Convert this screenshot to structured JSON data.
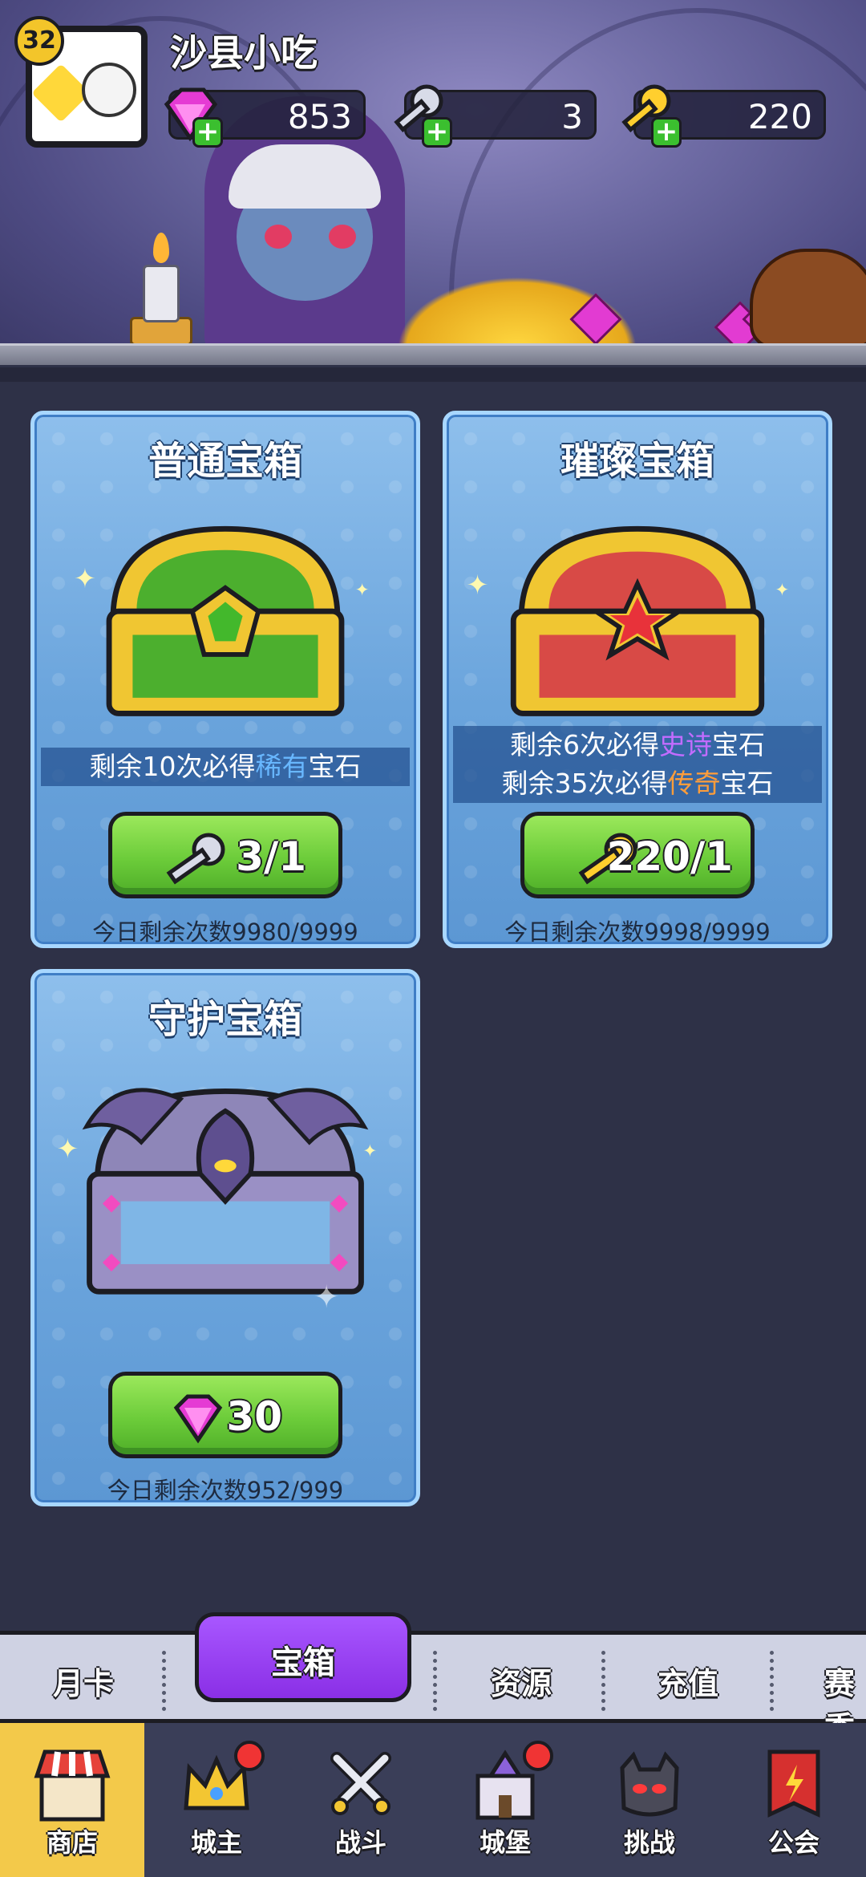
{
  "player": {
    "name": "沙县小吃",
    "level": "32"
  },
  "resources": [
    {
      "name": "gem",
      "value": "853"
    },
    {
      "name": "silver-key",
      "value": "3"
    },
    {
      "name": "gold-key",
      "value": "220"
    }
  ],
  "chests": {
    "normal": {
      "title": "普通宝箱",
      "pity_prefix": "剩余10次必得",
      "pity_rarity": "稀有",
      "pity_suffix": "宝石",
      "cost": "3/1",
      "cost_icon": "silver-key-icon",
      "daily": "今日剩余次数9980/9999"
    },
    "brilliant": {
      "title": "璀璨宝箱",
      "pity1_prefix": "剩余6次必得",
      "pity1_rarity": "史诗",
      "pity1_suffix": "宝石",
      "pity2_prefix": "剩余35次必得",
      "pity2_rarity": "传奇",
      "pity2_suffix": "宝石",
      "cost": "220/1",
      "cost_icon": "gold-key-icon",
      "daily": "今日剩余次数9998/9999"
    },
    "guardian": {
      "title": "守护宝箱",
      "cost": "30",
      "cost_icon": "gem-icon",
      "daily": "今日剩余次数952/999"
    }
  },
  "subtabs": {
    "monthly": "月卡",
    "chest": "宝箱",
    "resources": "资源",
    "recharge": "充值",
    "season": "赛季"
  },
  "nav": {
    "shop": "商店",
    "lord": "城主",
    "battle": "战斗",
    "castle": "城堡",
    "challenge": "挑战",
    "guild": "公会"
  },
  "colors": {
    "card_blue": "#6aa4dc",
    "button_green": "#6ccc3a",
    "active_tab": "#a857ff",
    "epic": "#c26cff",
    "legend": "#ff9d3a",
    "rare": "#68b7ff",
    "nav_active": "#f3c94a"
  }
}
